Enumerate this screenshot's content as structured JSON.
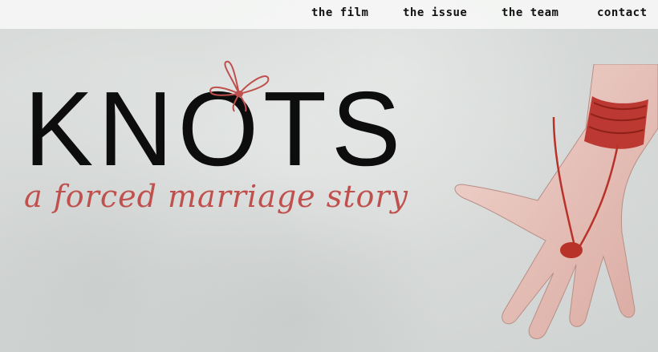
{
  "nav": {
    "items": [
      {
        "label": "the film"
      },
      {
        "label": "the issue"
      },
      {
        "label": "the team"
      },
      {
        "label": "contact"
      }
    ]
  },
  "hero": {
    "title": "KNOTS",
    "tagline": "a forced marriage story"
  },
  "colors": {
    "accent": "#c0504d",
    "text": "#0d0d0d",
    "background": "#d9dcda",
    "navbar": "#f5f6f5",
    "thread": "#b8322a",
    "skin": "#e8c8c0"
  },
  "icons": {
    "bow": "bow-icon",
    "hand": "hand-illustration"
  }
}
